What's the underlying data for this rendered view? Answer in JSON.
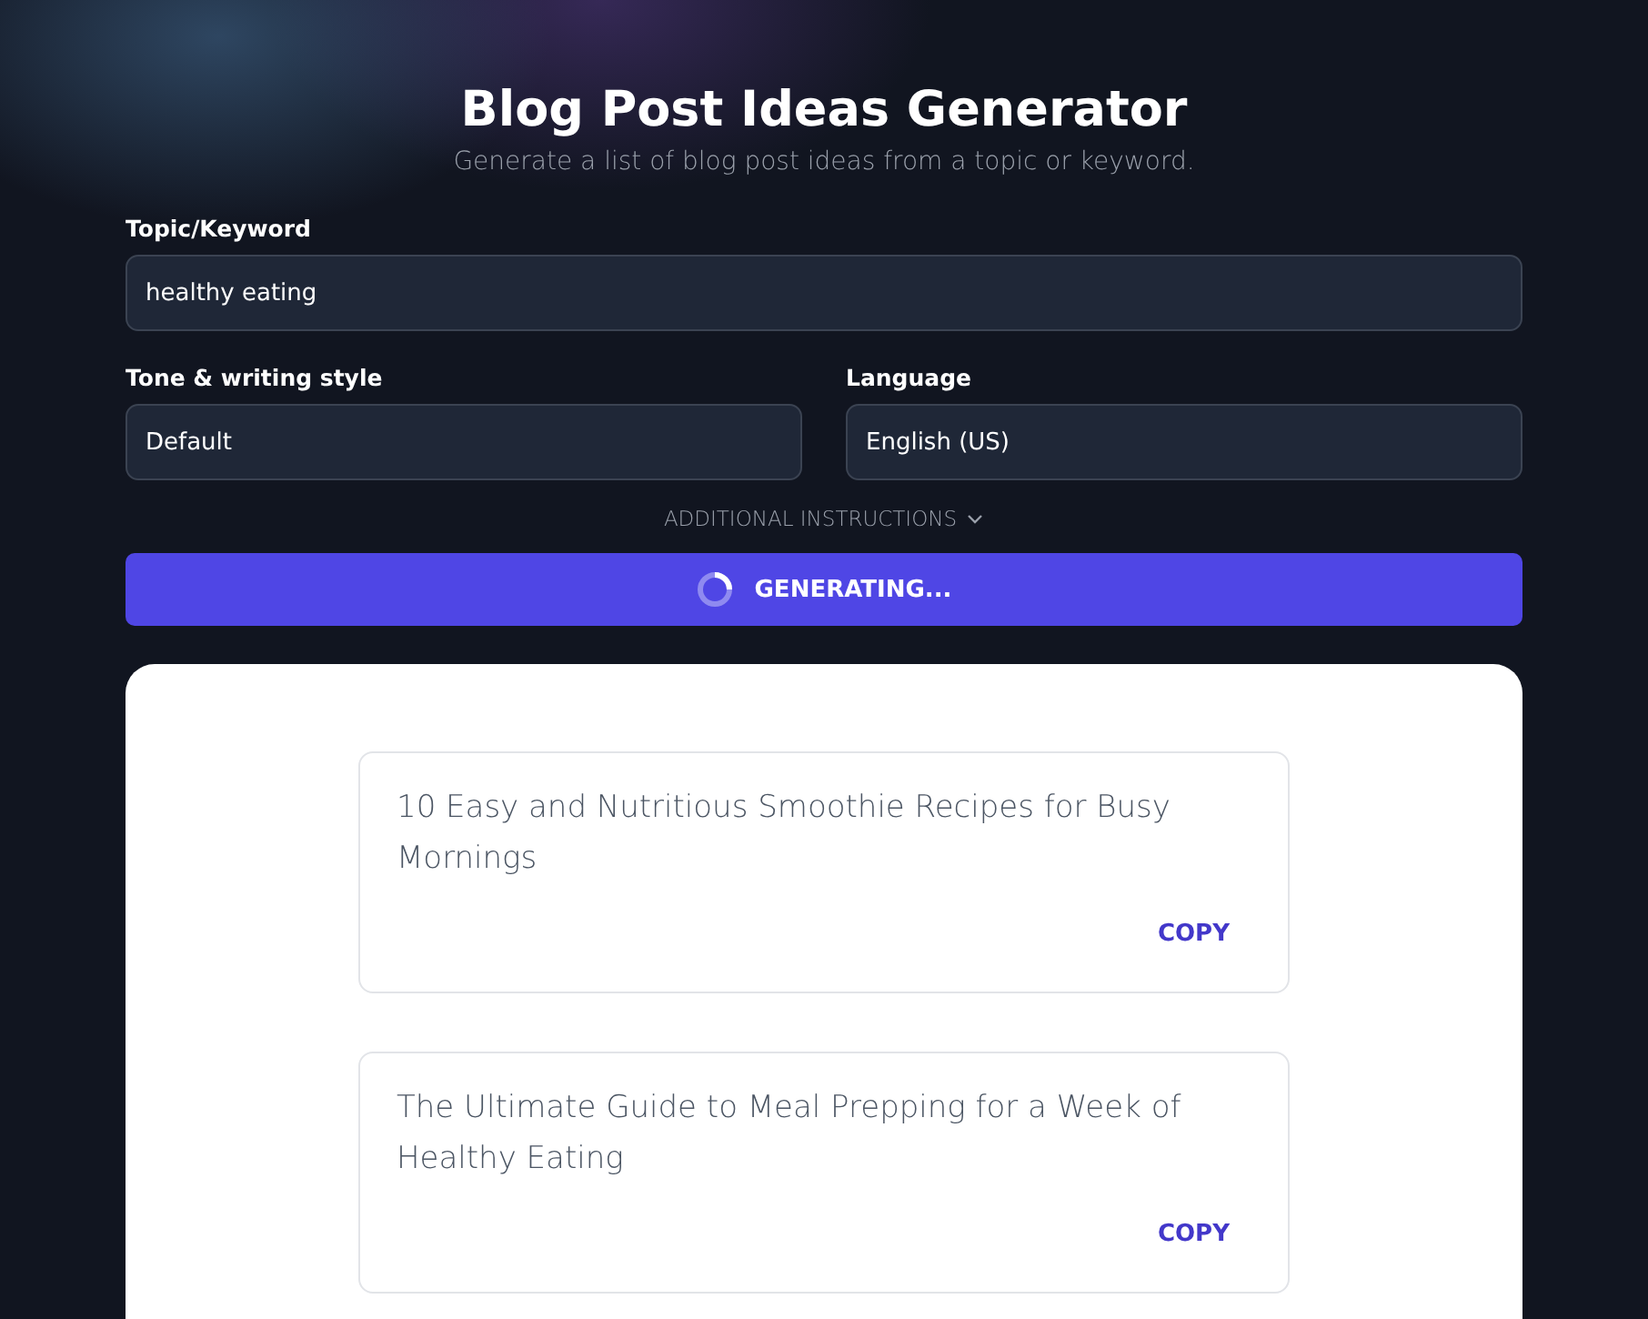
{
  "header": {
    "title": "Blog Post Ideas Generator",
    "subtitle": "Generate a list of blog post ideas from a topic or keyword."
  },
  "topic": {
    "label": "Topic/Keyword",
    "value": "healthy eating"
  },
  "selects": [
    {
      "label": "Tone & writing style",
      "value": "Default"
    },
    {
      "label": "Language",
      "value": "English (US)"
    }
  ],
  "additional_instructions": {
    "label": "ADDITIONAL INSTRUCTIONS",
    "expanded": false
  },
  "generate_button": {
    "label": "GENERATING...",
    "loading": true
  },
  "ideas": [
    {
      "text": "10 Easy and Nutritious Smoothie Recipes for Busy Mornings",
      "action": "COPY"
    },
    {
      "text": "The Ultimate Guide to Meal Prepping for a Week of Healthy Eating",
      "action": "COPY"
    }
  ]
}
